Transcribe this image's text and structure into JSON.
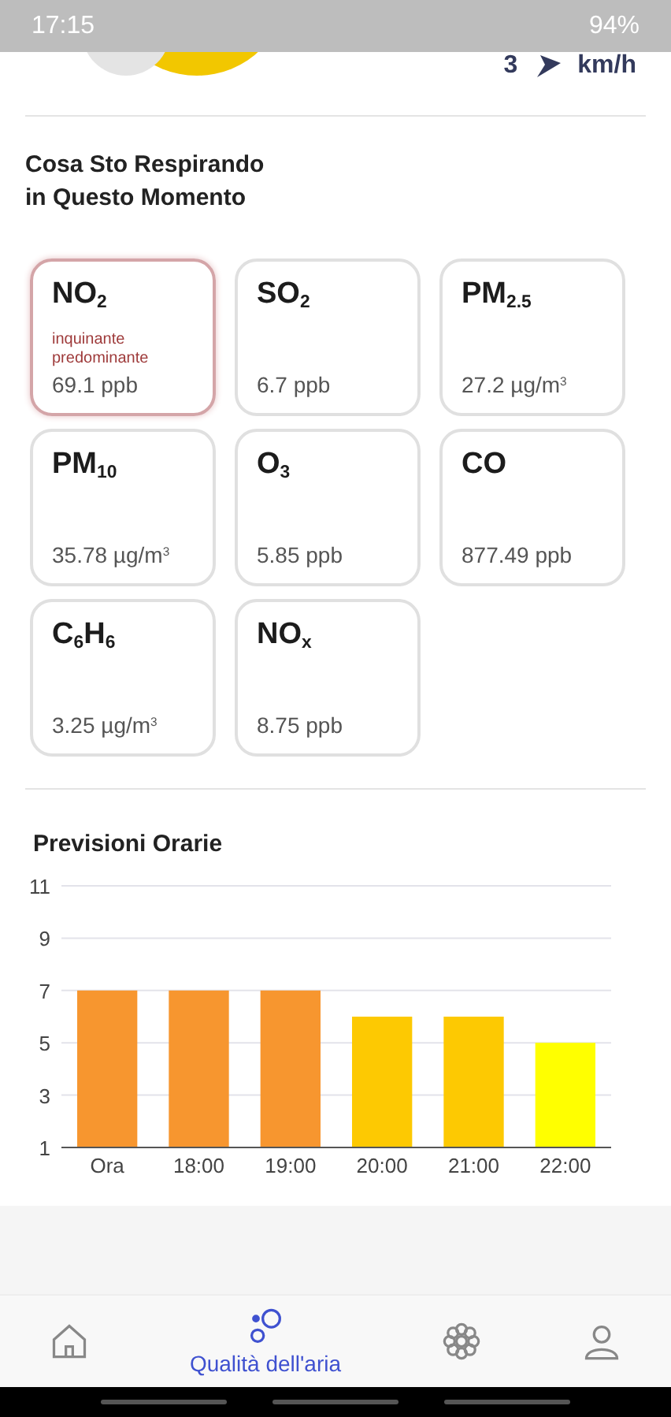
{
  "status_bar": {
    "time": "17:15",
    "battery": "94%"
  },
  "wind": {
    "speed": "3",
    "unit": "km/h"
  },
  "pollutants": {
    "title": "Cosa Sto Respirando\nin Questo Momento",
    "cards": [
      {
        "name": "NO$_{2}$",
        "value": "69.1 ppb",
        "dominant": true,
        "note": "inquinante predominante"
      },
      {
        "name": "SO$_{2}$",
        "value": "6.7 ppb",
        "dominant": false
      },
      {
        "name": "PM$_{2.5}$",
        "value": "27.2 µg/m$^{3}$",
        "dominant": false
      },
      {
        "name": "PM$_{10}$",
        "value": "35.78 µg/m$^{3}$",
        "dominant": false
      },
      {
        "name": "O$_{3}$",
        "value": "5.85 ppb",
        "dominant": false
      },
      {
        "name": "CO",
        "value": "877.49 ppb",
        "dominant": false
      },
      {
        "name": "C$_{6}$H$_{6}$",
        "value": "3.25 µg/m$^{3}$",
        "dominant": false
      },
      {
        "name": "NO$_{x}$",
        "value": "8.75 ppb",
        "dominant": false
      }
    ]
  },
  "forecast": {
    "title": "Previsioni Orarie",
    "chart_data": {
      "type": "bar",
      "categories": [
        "Ora",
        "18:00",
        "19:00",
        "20:00",
        "21:00",
        "22:00"
      ],
      "stacked": true,
      "grid": true,
      "ylim": [
        1,
        11
      ],
      "yticks": [
        1,
        3,
        5,
        7,
        9,
        11
      ],
      "series": [
        {
          "color": "#f7962f",
          "values": [
            7,
            7,
            7,
            null,
            null,
            null
          ]
        },
        {
          "color": "#fdc902",
          "values": [
            null,
            null,
            null,
            6,
            6,
            null
          ]
        },
        {
          "color": "#ffff00",
          "values": [
            null,
            null,
            null,
            null,
            null,
            5
          ]
        }
      ]
    }
  },
  "bottom_nav": [
    {
      "kind": "home",
      "selected": false
    },
    {
      "kind": "air",
      "label": "Qualità dell'aria",
      "selected": true
    },
    {
      "kind": "flower",
      "selected": false
    },
    {
      "kind": "profile",
      "selected": false
    }
  ]
}
